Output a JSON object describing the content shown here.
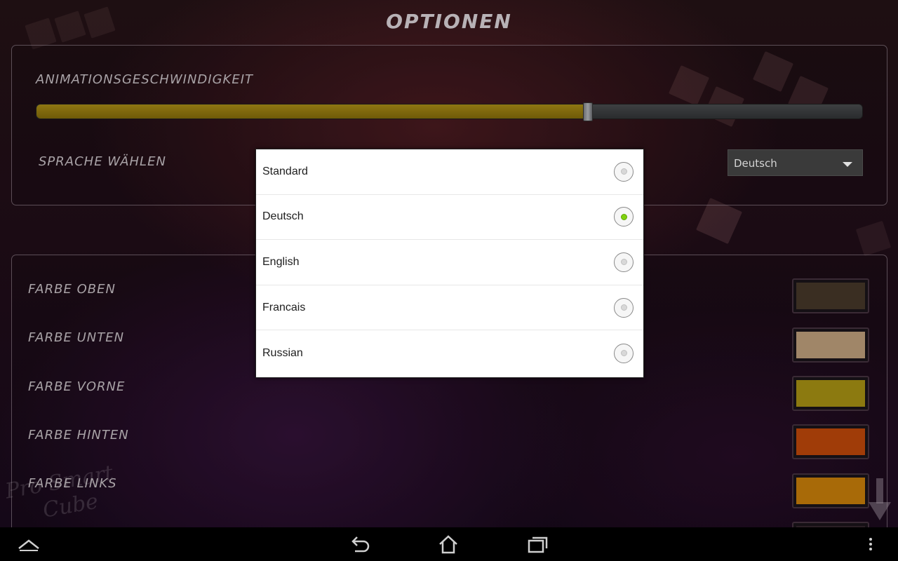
{
  "header": {
    "title": "OPTIONEN"
  },
  "animation": {
    "label": "ANIMATIONSGESCHWINDIGKEIT",
    "value_fraction": 0.668
  },
  "language": {
    "label": "SPRACHE WÄHLEN",
    "selected": "Deutsch"
  },
  "colors": [
    {
      "label": "FARBE OBEN",
      "color": "#3a2e22"
    },
    {
      "label": "FARBE UNTEN",
      "color": "#a08668"
    },
    {
      "label": "FARBE VORNE",
      "color": "#8c7a10"
    },
    {
      "label": "FARBE HINTEN",
      "color": "#a03c08"
    },
    {
      "label": "FARBE LINKS",
      "color": "#a86a08"
    }
  ],
  "watermark": {
    "line1": "Pro Smart",
    "line2": "Cube"
  },
  "dialog": {
    "options": [
      {
        "label": "Standard",
        "checked": false
      },
      {
        "label": "Deutsch",
        "checked": true
      },
      {
        "label": "English",
        "checked": false
      },
      {
        "label": "Francais",
        "checked": false
      },
      {
        "label": "Russian",
        "checked": false
      }
    ]
  },
  "navbar": {
    "icons": [
      "chevron-up-icon",
      "back-icon",
      "home-icon",
      "recent-apps-icon",
      "overflow-menu-icon"
    ]
  },
  "theme": {
    "accent": "#7fd10e",
    "slider_fill": "#8f7612"
  }
}
